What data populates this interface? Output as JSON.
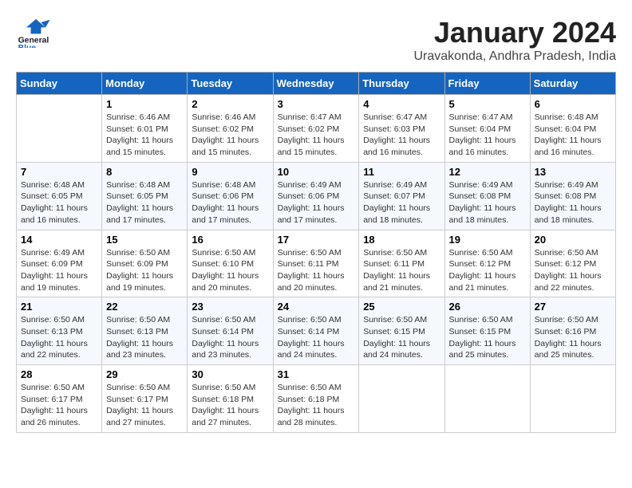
{
  "header": {
    "logo_line1": "General",
    "logo_line2": "Blue",
    "month_title": "January 2024",
    "location": "Uravakonda, Andhra Pradesh, India"
  },
  "weekdays": [
    "Sunday",
    "Monday",
    "Tuesday",
    "Wednesday",
    "Thursday",
    "Friday",
    "Saturday"
  ],
  "weeks": [
    [
      {
        "day": null,
        "info": null
      },
      {
        "day": "1",
        "info": "Sunrise: 6:46 AM\nSunset: 6:01 PM\nDaylight: 11 hours\nand 15 minutes."
      },
      {
        "day": "2",
        "info": "Sunrise: 6:46 AM\nSunset: 6:02 PM\nDaylight: 11 hours\nand 15 minutes."
      },
      {
        "day": "3",
        "info": "Sunrise: 6:47 AM\nSunset: 6:02 PM\nDaylight: 11 hours\nand 15 minutes."
      },
      {
        "day": "4",
        "info": "Sunrise: 6:47 AM\nSunset: 6:03 PM\nDaylight: 11 hours\nand 16 minutes."
      },
      {
        "day": "5",
        "info": "Sunrise: 6:47 AM\nSunset: 6:04 PM\nDaylight: 11 hours\nand 16 minutes."
      },
      {
        "day": "6",
        "info": "Sunrise: 6:48 AM\nSunset: 6:04 PM\nDaylight: 11 hours\nand 16 minutes."
      }
    ],
    [
      {
        "day": "7",
        "info": "Sunrise: 6:48 AM\nSunset: 6:05 PM\nDaylight: 11 hours\nand 16 minutes."
      },
      {
        "day": "8",
        "info": "Sunrise: 6:48 AM\nSunset: 6:05 PM\nDaylight: 11 hours\nand 17 minutes."
      },
      {
        "day": "9",
        "info": "Sunrise: 6:48 AM\nSunset: 6:06 PM\nDaylight: 11 hours\nand 17 minutes."
      },
      {
        "day": "10",
        "info": "Sunrise: 6:49 AM\nSunset: 6:06 PM\nDaylight: 11 hours\nand 17 minutes."
      },
      {
        "day": "11",
        "info": "Sunrise: 6:49 AM\nSunset: 6:07 PM\nDaylight: 11 hours\nand 18 minutes."
      },
      {
        "day": "12",
        "info": "Sunrise: 6:49 AM\nSunset: 6:08 PM\nDaylight: 11 hours\nand 18 minutes."
      },
      {
        "day": "13",
        "info": "Sunrise: 6:49 AM\nSunset: 6:08 PM\nDaylight: 11 hours\nand 18 minutes."
      }
    ],
    [
      {
        "day": "14",
        "info": "Sunrise: 6:49 AM\nSunset: 6:09 PM\nDaylight: 11 hours\nand 19 minutes."
      },
      {
        "day": "15",
        "info": "Sunrise: 6:50 AM\nSunset: 6:09 PM\nDaylight: 11 hours\nand 19 minutes."
      },
      {
        "day": "16",
        "info": "Sunrise: 6:50 AM\nSunset: 6:10 PM\nDaylight: 11 hours\nand 20 minutes."
      },
      {
        "day": "17",
        "info": "Sunrise: 6:50 AM\nSunset: 6:11 PM\nDaylight: 11 hours\nand 20 minutes."
      },
      {
        "day": "18",
        "info": "Sunrise: 6:50 AM\nSunset: 6:11 PM\nDaylight: 11 hours\nand 21 minutes."
      },
      {
        "day": "19",
        "info": "Sunrise: 6:50 AM\nSunset: 6:12 PM\nDaylight: 11 hours\nand 21 minutes."
      },
      {
        "day": "20",
        "info": "Sunrise: 6:50 AM\nSunset: 6:12 PM\nDaylight: 11 hours\nand 22 minutes."
      }
    ],
    [
      {
        "day": "21",
        "info": "Sunrise: 6:50 AM\nSunset: 6:13 PM\nDaylight: 11 hours\nand 22 minutes."
      },
      {
        "day": "22",
        "info": "Sunrise: 6:50 AM\nSunset: 6:13 PM\nDaylight: 11 hours\nand 23 minutes."
      },
      {
        "day": "23",
        "info": "Sunrise: 6:50 AM\nSunset: 6:14 PM\nDaylight: 11 hours\nand 23 minutes."
      },
      {
        "day": "24",
        "info": "Sunrise: 6:50 AM\nSunset: 6:14 PM\nDaylight: 11 hours\nand 24 minutes."
      },
      {
        "day": "25",
        "info": "Sunrise: 6:50 AM\nSunset: 6:15 PM\nDaylight: 11 hours\nand 24 minutes."
      },
      {
        "day": "26",
        "info": "Sunrise: 6:50 AM\nSunset: 6:15 PM\nDaylight: 11 hours\nand 25 minutes."
      },
      {
        "day": "27",
        "info": "Sunrise: 6:50 AM\nSunset: 6:16 PM\nDaylight: 11 hours\nand 25 minutes."
      }
    ],
    [
      {
        "day": "28",
        "info": "Sunrise: 6:50 AM\nSunset: 6:17 PM\nDaylight: 11 hours\nand 26 minutes."
      },
      {
        "day": "29",
        "info": "Sunrise: 6:50 AM\nSunset: 6:17 PM\nDaylight: 11 hours\nand 27 minutes."
      },
      {
        "day": "30",
        "info": "Sunrise: 6:50 AM\nSunset: 6:18 PM\nDaylight: 11 hours\nand 27 minutes."
      },
      {
        "day": "31",
        "info": "Sunrise: 6:50 AM\nSunset: 6:18 PM\nDaylight: 11 hours\nand 28 minutes."
      },
      {
        "day": null,
        "info": null
      },
      {
        "day": null,
        "info": null
      },
      {
        "day": null,
        "info": null
      }
    ]
  ]
}
